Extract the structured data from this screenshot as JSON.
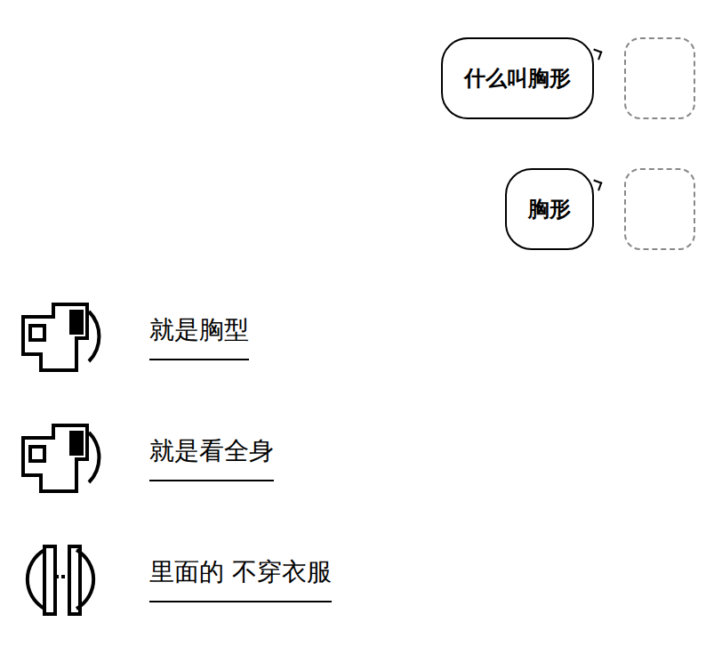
{
  "messages": [
    {
      "side": "out",
      "text": "什么叫胸形"
    },
    {
      "side": "out",
      "text": "胸形"
    },
    {
      "side": "in",
      "text": "就是胸型"
    },
    {
      "side": "in",
      "text": "就是看全身"
    },
    {
      "side": "in",
      "text": "里面的 不穿衣服"
    }
  ]
}
